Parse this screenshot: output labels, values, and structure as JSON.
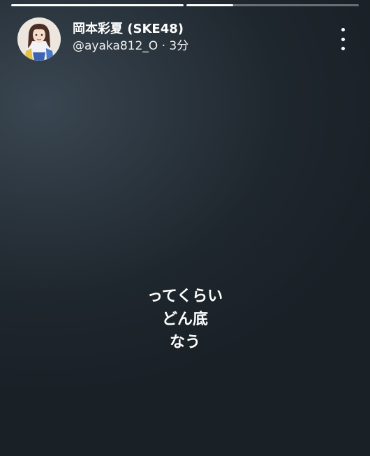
{
  "progress": {
    "segments": [
      {
        "fill": 1.0
      },
      {
        "fill": 0.27
      }
    ]
  },
  "user": {
    "display_name": "岡本彩夏 (SKE48)",
    "handle": "@ayaka812_O",
    "separator": "·",
    "time_ago": "3分"
  },
  "story": {
    "lines": [
      "ってくらい",
      "どん底",
      "なう"
    ]
  },
  "colors": {
    "background": "#1f272e",
    "text": "#ffffff"
  }
}
